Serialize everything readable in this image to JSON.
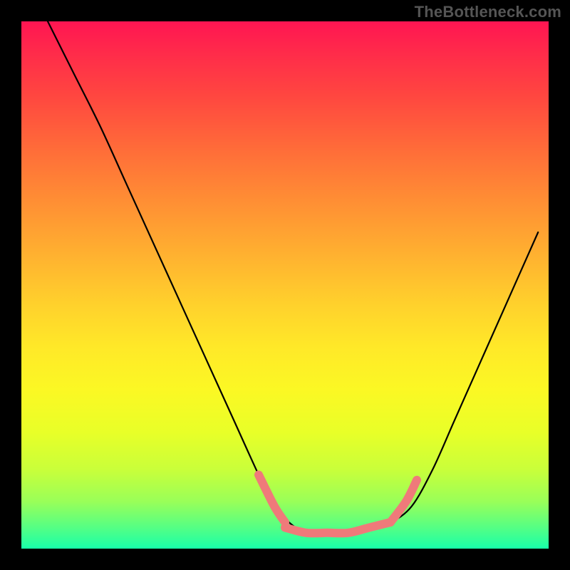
{
  "watermark": "TheBottleneck.com",
  "chart_data": {
    "type": "line",
    "title": "",
    "xlabel": "",
    "ylabel": "",
    "xlim": [
      0,
      100
    ],
    "ylim": [
      0,
      100
    ],
    "categories_note": "x is horizontal position 0–100 left→right; y is vertical position 0–100 bottom→top; values read from pixel positions on a normalized 0–100 grid",
    "series": [
      {
        "name": "curve",
        "color": "#000000",
        "x": [
          5,
          10,
          15,
          20,
          25,
          30,
          35,
          40,
          45,
          48,
          52,
          55,
          58,
          62,
          66,
          70,
          74,
          78,
          82,
          86,
          90,
          94,
          98
        ],
        "y": [
          100,
          90,
          80,
          69,
          58,
          47,
          36,
          25,
          14,
          8,
          4,
          3,
          3,
          3,
          4,
          5,
          8,
          15,
          24,
          33,
          42,
          51,
          60
        ]
      }
    ],
    "highlight_segments": [
      {
        "name": "left-pink-segment",
        "color": "#ef7a7a",
        "x": [
          45,
          48,
          50
        ],
        "y": [
          14,
          8,
          5
        ]
      },
      {
        "name": "bottom-pink-segment",
        "color": "#ef7a7a",
        "x": [
          50,
          54,
          58,
          62,
          66,
          70
        ],
        "y": [
          4,
          3,
          3,
          3,
          4,
          5
        ]
      },
      {
        "name": "right-pink-segment",
        "color": "#ef7a7a",
        "x": [
          70,
          73,
          75
        ],
        "y": [
          5,
          9,
          13
        ]
      }
    ],
    "annotations": []
  }
}
